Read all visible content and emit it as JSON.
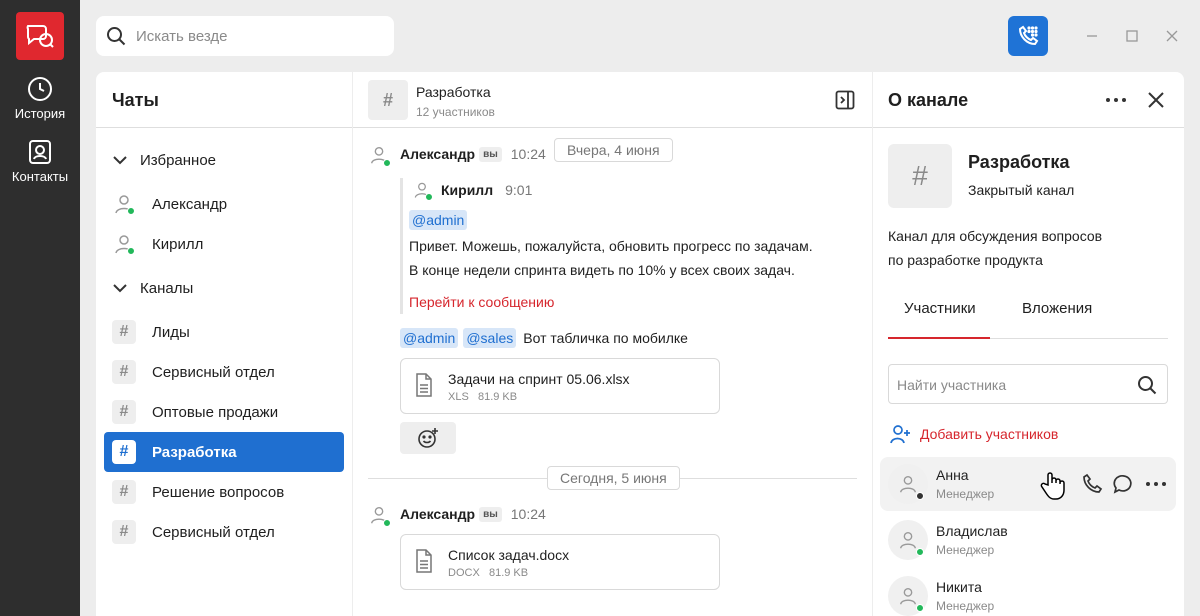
{
  "rail": {
    "history_label": "История",
    "contacts_label": "Контакты"
  },
  "topbar": {
    "search_placeholder": "Искать везде"
  },
  "sidebar": {
    "title": "Чаты",
    "favorites_label": "Избранное",
    "favorites": [
      {
        "name": "Александр",
        "status": "online"
      },
      {
        "name": "Кирилл",
        "status": "online"
      }
    ],
    "channels_label": "Каналы",
    "channels": [
      {
        "name": "Лиды",
        "active": false
      },
      {
        "name": "Сервисный отдел",
        "active": false
      },
      {
        "name": "Оптовые продажи",
        "active": false
      },
      {
        "name": "Разработка",
        "active": true
      },
      {
        "name": "Решение вопросов",
        "active": false
      },
      {
        "name": "Сервисный отдел",
        "active": false
      }
    ]
  },
  "chat": {
    "channel_name": "Разработка",
    "participants": "12 участников",
    "msg1": {
      "author": "Александр",
      "me_badge": "вы",
      "time": "10:24",
      "date_pill": "Вчера, 4 июня",
      "quote": {
        "author": "Кирилл",
        "time": "9:01",
        "mention": "@admin",
        "line1": "Привет. Можешь, пожалуйста, обновить прогресс по задачам.",
        "line2": "В конце недели спринта видеть по 10% у всех своих задач.",
        "link": "Перейти к сообщению"
      },
      "mention1": "@admin",
      "mention2": "@sales",
      "text": "Вот табличка по мобилке",
      "file": {
        "name": "Задачи на спринт 05.06.xlsx",
        "ext": "XLS",
        "size": "81.9 KB"
      }
    },
    "today_pill": "Сегодня, 5 июня",
    "msg2": {
      "author": "Александр",
      "me_badge": "вы",
      "time": "10:24",
      "file": {
        "name": "Список задач.docx",
        "ext": "DOCX",
        "size": "81.9 KB"
      }
    }
  },
  "info": {
    "title": "О канале",
    "channel_name": "Разработка",
    "channel_type": "Закрытый канал",
    "description_line1": "Канал для обсуждения вопросов",
    "description_line2": "по разработке продукта",
    "tab_members": "Участники",
    "tab_attachments": "Вложения",
    "member_search_placeholder": "Найти участника",
    "add_members": "Добавить участников",
    "members": [
      {
        "name": "Анна",
        "role": "Менеджер",
        "status": "offline"
      },
      {
        "name": "Владислав",
        "role": "Менеджер",
        "status": "online"
      },
      {
        "name": "Никита",
        "role": "Менеджер",
        "status": "online"
      }
    ]
  },
  "colors": {
    "brand_red": "#e0282f",
    "accent_blue": "#1f6fd0",
    "online_green": "#22b85a",
    "link_red": "#d6262d"
  }
}
